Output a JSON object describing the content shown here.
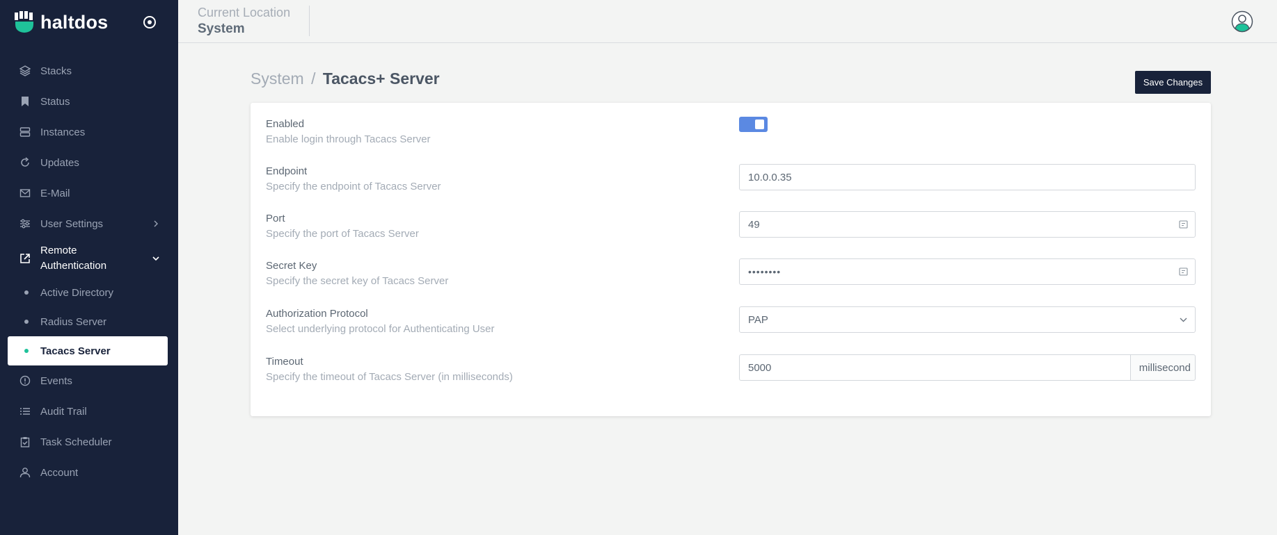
{
  "brand": {
    "name": "haltdos"
  },
  "header": {
    "location_label": "Current Location",
    "location_value": "System"
  },
  "sidebar": {
    "items": [
      {
        "label": "Stacks",
        "icon": "layers-icon"
      },
      {
        "label": "Status",
        "icon": "bookmark-icon"
      },
      {
        "label": "Instances",
        "icon": "server-icon"
      },
      {
        "label": "Updates",
        "icon": "refresh-icon"
      },
      {
        "label": "E-Mail",
        "icon": "mail-icon"
      },
      {
        "label": "User Settings",
        "icon": "sliders-icon"
      },
      {
        "label": "Remote Authentication",
        "icon": "external-link-icon"
      },
      {
        "label": "Events",
        "icon": "alert-circle-icon"
      },
      {
        "label": "Audit Trail",
        "icon": "list-icon"
      },
      {
        "label": "Task Scheduler",
        "icon": "clipboard-check-icon"
      },
      {
        "label": "Account",
        "icon": "user-icon"
      }
    ],
    "sub_items": [
      {
        "label": "Active Directory"
      },
      {
        "label": "Radius Server"
      },
      {
        "label": "Tacacs Server"
      }
    ]
  },
  "breadcrumb": {
    "parent": "System",
    "separator": "/",
    "current": "Tacacs+ Server"
  },
  "toolbar": {
    "save_label": "Save Changes"
  },
  "form": {
    "enabled": {
      "title": "Enabled",
      "desc": "Enable login through Tacacs Server",
      "value": true
    },
    "endpoint": {
      "title": "Endpoint",
      "desc": "Specify the endpoint of Tacacs Server",
      "value": "10.0.0.35"
    },
    "port": {
      "title": "Port",
      "desc": "Specify the port of Tacacs Server",
      "value": "49"
    },
    "secret": {
      "title": "Secret Key",
      "desc": "Specify the secret key of Tacacs Server",
      "value": "••••••••"
    },
    "protocol": {
      "title": "Authorization Protocol",
      "desc": "Select underlying protocol for Authenticating User",
      "value": "PAP"
    },
    "timeout": {
      "title": "Timeout",
      "desc": "Specify the timeout of Tacacs Server (in milliseconds)",
      "value": "5000",
      "unit": "millisecond"
    }
  },
  "colors": {
    "sidebar_bg": "#18223a",
    "accent": "#1fc29a",
    "toggle_on": "#5b89e2",
    "button_bg": "#18223a"
  }
}
